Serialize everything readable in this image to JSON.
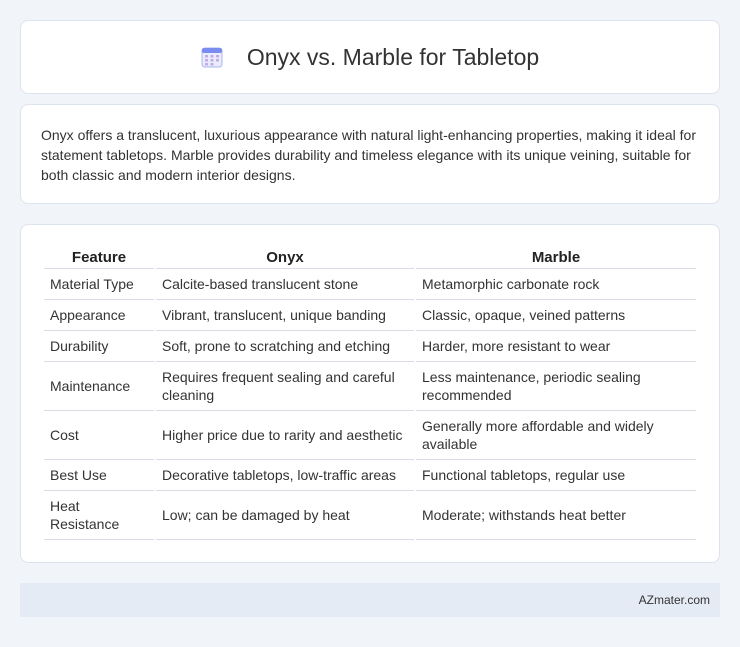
{
  "header": {
    "title": "Onyx vs. Marble for Tabletop",
    "icon": "calendar-icon"
  },
  "intro": {
    "text": "Onyx offers a translucent, luxurious appearance with natural light-enhancing properties, making it ideal for statement tabletops. Marble provides durability and timeless elegance with its unique veining, suitable for both classic and modern interior designs."
  },
  "table": {
    "headers": [
      "Feature",
      "Onyx",
      "Marble"
    ],
    "rows": [
      [
        "Material Type",
        "Calcite-based translucent stone",
        "Metamorphic carbonate rock"
      ],
      [
        "Appearance",
        "Vibrant, translucent, unique banding",
        "Classic, opaque, veined patterns"
      ],
      [
        "Durability",
        "Soft, prone to scratching and etching",
        "Harder, more resistant to wear"
      ],
      [
        "Maintenance",
        "Requires frequent sealing and careful cleaning",
        "Less maintenance, periodic sealing recommended"
      ],
      [
        "Cost",
        "Higher price due to rarity and aesthetic",
        "Generally more affordable and widely available"
      ],
      [
        "Best Use",
        "Decorative tabletops, low-traffic areas",
        "Functional tabletops, regular use"
      ],
      [
        "Heat Resistance",
        "Low; can be damaged by heat",
        "Moderate; withstands heat better"
      ]
    ]
  },
  "footer": {
    "text": "AZmater.com"
  },
  "colors": {
    "background": "#f1f4f9",
    "card": "#ffffff",
    "footer_bg": "#e4ebf4",
    "icon_accent": "#7b8cf0"
  }
}
